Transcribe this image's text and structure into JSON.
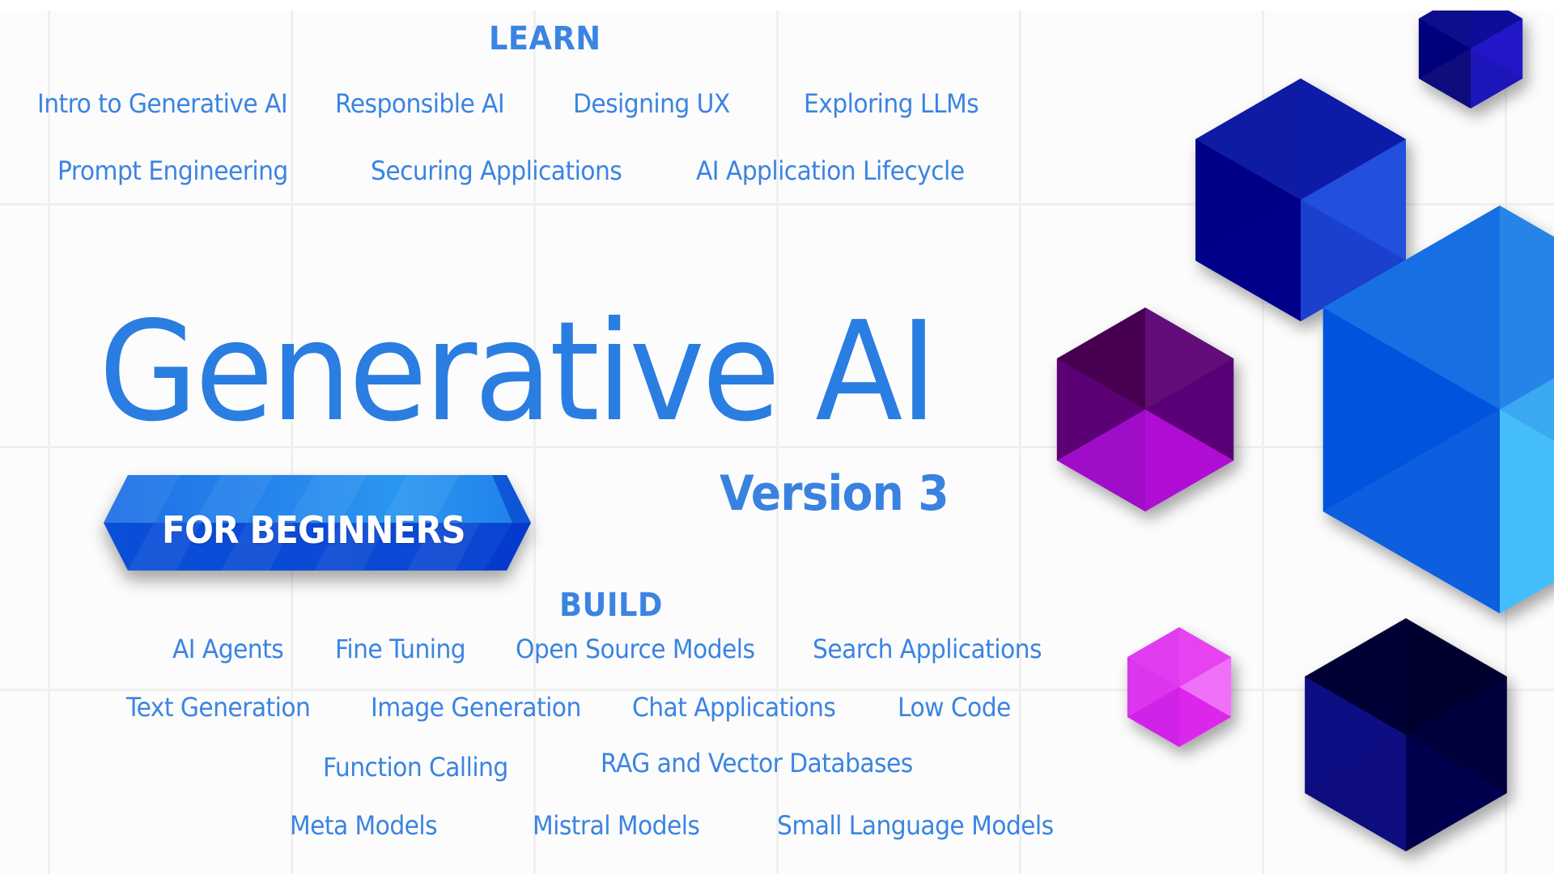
{
  "title": "Generative AI",
  "version": "Version 3",
  "badge": "FOR BEGINNERS",
  "learn": {
    "heading": "LEARN",
    "items": [
      "Intro to Generative AI",
      "Responsible AI",
      "Designing UX",
      "Exploring LLMs",
      "Prompt Engineering",
      "Securing Applications",
      "AI Application Lifecycle"
    ]
  },
  "build": {
    "heading": "BUILD",
    "items": [
      "AI Agents",
      "Fine Tuning",
      "Open Source Models",
      "Search Applications",
      "Text Generation",
      "Image Generation",
      "Chat Applications",
      "Low Code",
      "Function Calling",
      "RAG and Vector Databases",
      "Meta Models",
      "Mistral Models",
      "Small Language Models"
    ]
  },
  "colors": {
    "text_blue": "#3b84e2",
    "title_blue": "#2a7de1",
    "grid": "#f0f0f0",
    "background": "#fcfcfc"
  },
  "decorations": [
    "hexagon-cube-navy-small",
    "hexagon-cube-royal-blue",
    "hexagon-cube-sky-blue-large",
    "hexagon-cube-purple",
    "hexagon-cube-magenta",
    "hexagon-cube-midnight"
  ]
}
